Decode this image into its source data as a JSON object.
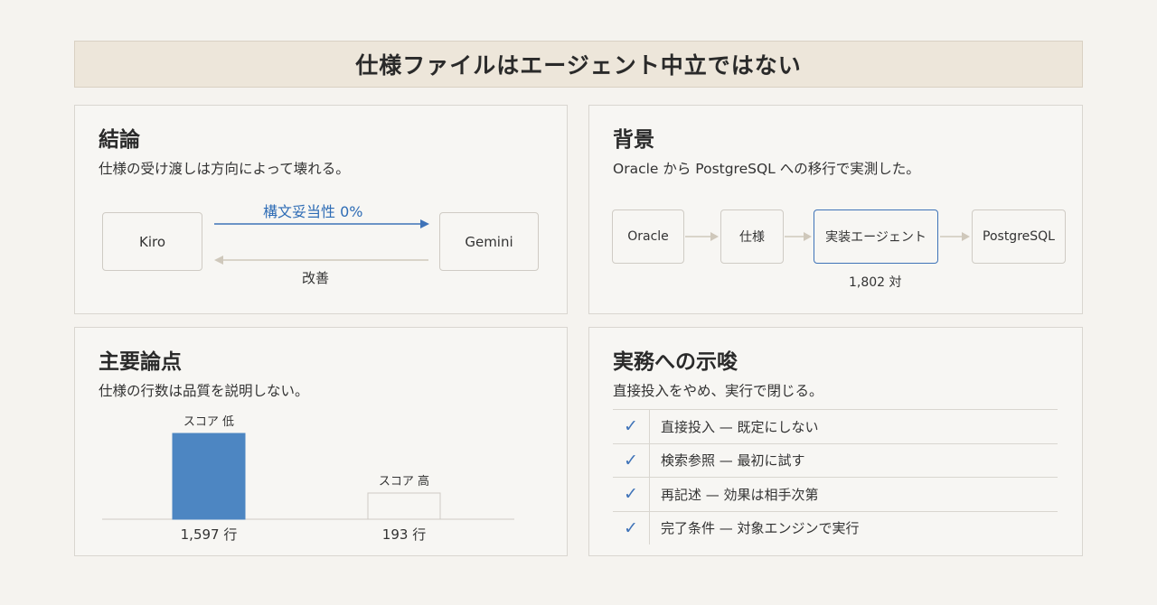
{
  "title": "仕様ファイルはエージェント中立ではない",
  "conclusion": {
    "heading": "結論",
    "subtitle": "仕様の受け渡しは方向によって壊れる。",
    "left_node": "Kiro",
    "right_node": "Gemini",
    "forward_label": "構文妥当性 0%",
    "backward_label": "改善",
    "accent_color": "#2e6cb5"
  },
  "background": {
    "heading": "背景",
    "subtitle": "Oracle から PostgreSQL への移行で実測した。",
    "nodes": [
      "Oracle",
      "仕様",
      "実装エージェント",
      "PostgreSQL"
    ],
    "pair_count": "1,802 対"
  },
  "points": {
    "heading": "主要論点",
    "subtitle": "仕様の行数は品質を説明しない。",
    "chart_data": {
      "type": "bar",
      "categories": [
        "1,597 行",
        "193 行"
      ],
      "values": [
        1597,
        193
      ],
      "annotations": [
        "スコア 低",
        "スコア 高"
      ],
      "bar_colors": [
        "#4d86c2",
        "#f7f6f3"
      ]
    }
  },
  "practice": {
    "heading": "実務への示唆",
    "subtitle": "直接投入をやめ、実行で閉じる。",
    "items": [
      "直接投入 — 既定にしない",
      "検索参照 — 最初に試す",
      "再記述 — 効果は相手次第",
      "完了条件 — 対象エンジンで実行"
    ]
  }
}
